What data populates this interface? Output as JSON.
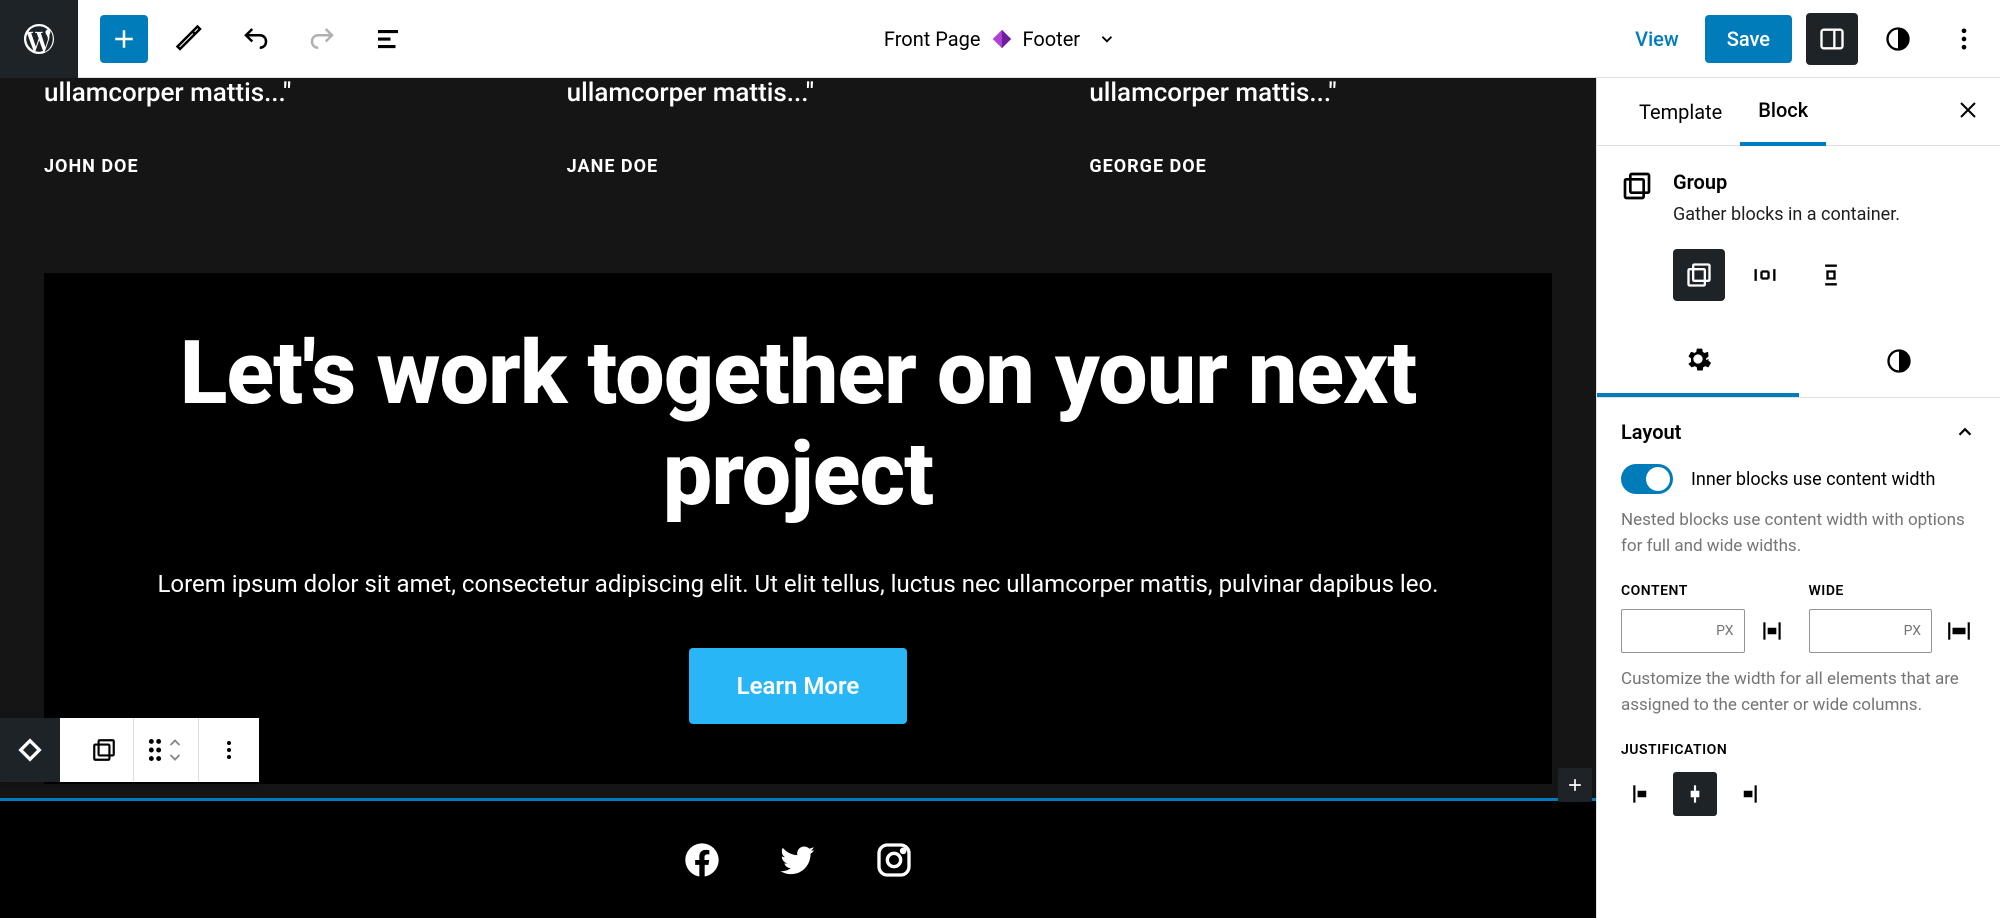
{
  "header": {
    "doc_page": "Front Page",
    "doc_part": "Footer",
    "view": "View",
    "save": "Save"
  },
  "canvas": {
    "testimonials": [
      {
        "quote": "ullamcorper mattis...\"",
        "name": "JOHN DOE"
      },
      {
        "quote": "ullamcorper mattis...\"",
        "name": "JANE DOE"
      },
      {
        "quote": "ullamcorper mattis...\"",
        "name": "GEORGE DOE"
      }
    ],
    "cta": {
      "heading": "Let's work together on your next project",
      "body": "Lorem ipsum dolor sit amet, consectetur adipiscing elit. Ut elit tellus, luctus nec ullamcorper mattis, pulvinar dapibus leo.",
      "button": "Learn More"
    }
  },
  "sidebar": {
    "tabs": {
      "template": "Template",
      "block": "Block"
    },
    "block": {
      "name": "Group",
      "desc": "Gather blocks in a container."
    },
    "layout": {
      "title": "Layout",
      "toggle_label": "Inner blocks use content width",
      "toggle_help": "Nested blocks use content width with options for full and wide widths.",
      "content_label": "CONTENT",
      "wide_label": "WIDE",
      "unit": "PX",
      "width_help": "Customize the width for all elements that are assigned to the center or wide columns.",
      "justification_label": "JUSTIFICATION"
    }
  }
}
